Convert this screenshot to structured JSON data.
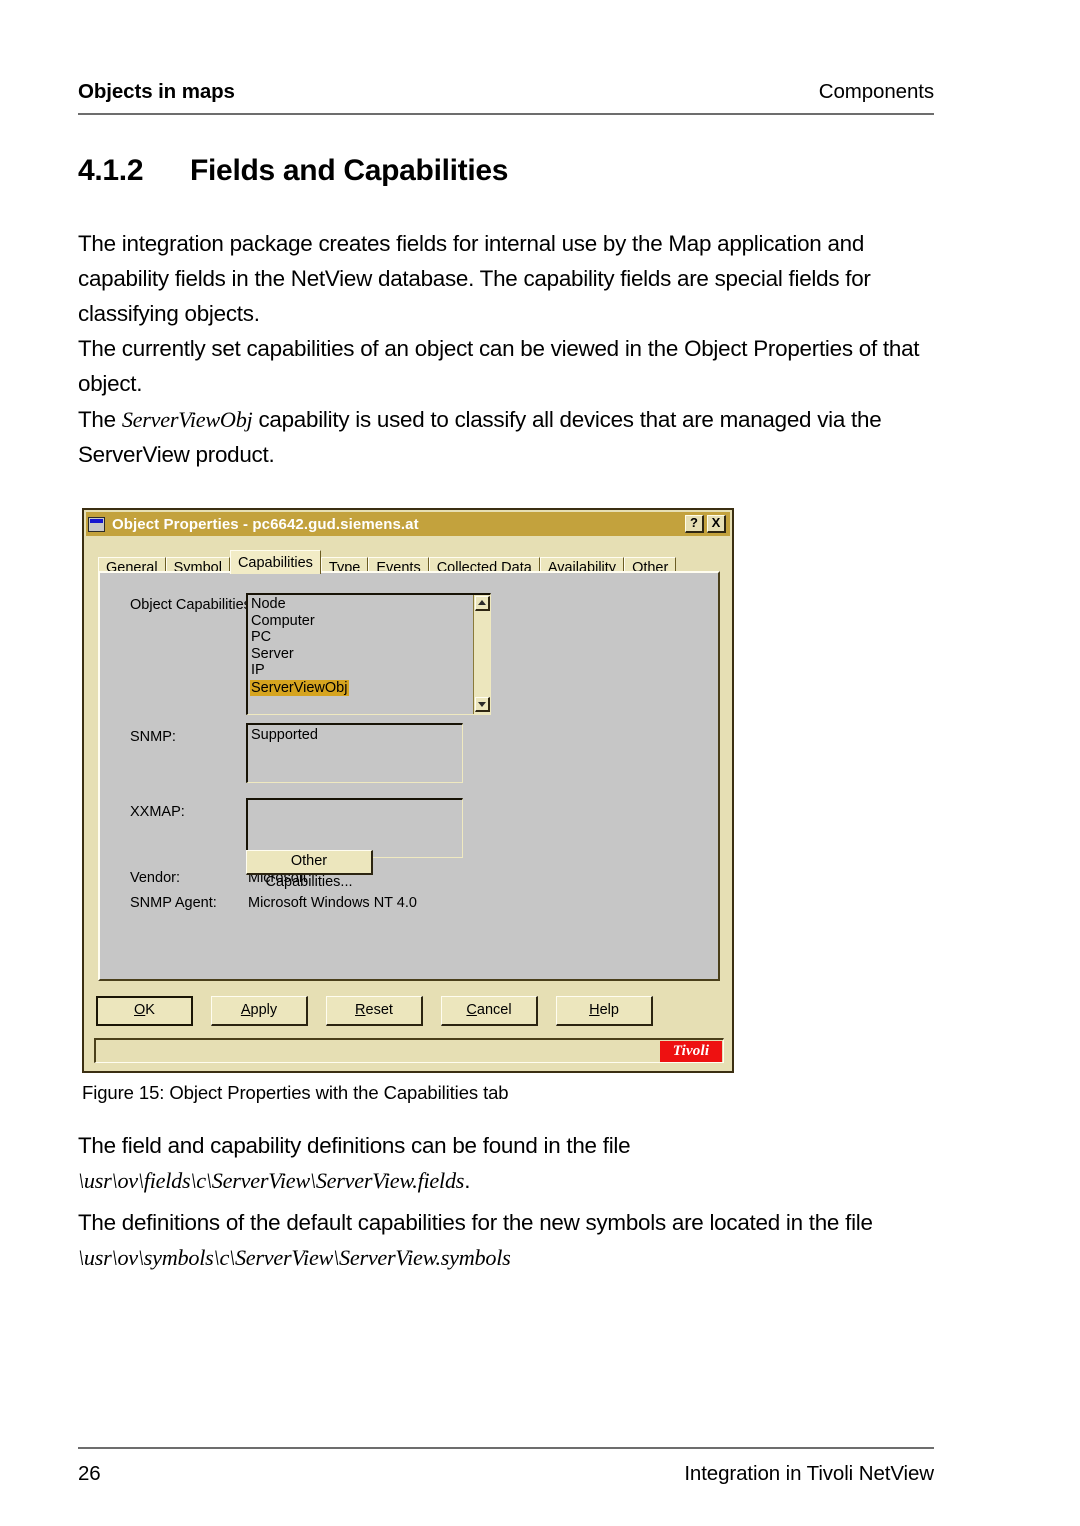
{
  "running_head": {
    "left": "Objects in maps",
    "right": "Components"
  },
  "section": {
    "number": "4.1.2",
    "title": "Fields and Capabilities"
  },
  "paragraphs": {
    "p1": "The integration package creates fields for internal use by the Map application and capability fields in the NetView database. The capability fields are special fields for classifying objects.",
    "p2": "The currently set capabilities of an object can be viewed in the Object Properties of that object.",
    "p3_before": "The ",
    "p3_italic": "ServerViewObj",
    "p3_after": " capability is used to classify all devices that are managed via the ServerView product.",
    "p4_before": "The field and capability definitions can be found in the file ",
    "p4_italic": "\\usr\\ov\\fields\\c\\ServerView\\ServerView.fields",
    "p4_after": ".",
    "p5_before": "The definitions of the default capabilities for the new symbols are located in the file ",
    "p5_italic": "\\usr\\ov\\symbols\\c\\ServerView\\ServerView.symbols"
  },
  "figure": {
    "caption": "Figure 15: Object Properties with the Capabilities tab"
  },
  "dialog": {
    "title": "Object Properties - pc6642.gud.siemens.at",
    "icon": "window-icon",
    "title_buttons": [
      {
        "name": "help-button",
        "label": "?"
      },
      {
        "name": "close-button",
        "label": "X"
      }
    ],
    "tabs": [
      {
        "label": "General",
        "active": false
      },
      {
        "label": "Symbol",
        "active": false
      },
      {
        "label": "Capabilities",
        "active": true
      },
      {
        "label": "Type",
        "active": false
      },
      {
        "label": "Events",
        "active": false
      },
      {
        "label": "Collected Data",
        "active": false
      },
      {
        "label": "Availability",
        "active": false
      },
      {
        "label": "Other",
        "active": false
      }
    ],
    "fields": {
      "object_capabilities_label": "Object Capabilities:",
      "object_capabilities_items": [
        {
          "text": "Node",
          "selected": false
        },
        {
          "text": "Computer",
          "selected": false
        },
        {
          "text": "PC",
          "selected": false
        },
        {
          "text": "Server",
          "selected": false
        },
        {
          "text": "IP",
          "selected": false
        },
        {
          "text": "ServerViewObj",
          "selected": true
        }
      ],
      "snmp_label": "SNMP:",
      "snmp_value": "Supported",
      "xxmap_label": "XXMAP:",
      "xxmap_value": "",
      "vendor_label": "Vendor:",
      "vendor_value": "Microsoft",
      "snmp_agent_label": "SNMP Agent:",
      "snmp_agent_value": "Microsoft Windows NT 4.0",
      "other_capabilities_button": "Other Capabilities..."
    },
    "buttons": [
      {
        "name": "ok-button",
        "pre": "",
        "key": "O",
        "post": "K",
        "default": true
      },
      {
        "name": "apply-button",
        "pre": "",
        "key": "A",
        "post": "pply",
        "default": false
      },
      {
        "name": "reset-button",
        "pre": "",
        "key": "R",
        "post": "eset",
        "default": false
      },
      {
        "name": "cancel-button",
        "pre": "",
        "key": "C",
        "post": "ancel",
        "default": false
      },
      {
        "name": "help-button",
        "pre": "",
        "key": "H",
        "post": "elp",
        "default": false
      }
    ],
    "statusbar": {
      "logo": "Tivoli"
    },
    "colors": {
      "titlebar": "#c3a23d",
      "dialog_face": "#e6dfb4",
      "tab_page": "#c6c6c6",
      "selection": "#d6a41f",
      "tivoli_red": "#ee1111"
    }
  },
  "footer": {
    "page_number": "26",
    "book_title": "Integration in Tivoli NetView"
  }
}
